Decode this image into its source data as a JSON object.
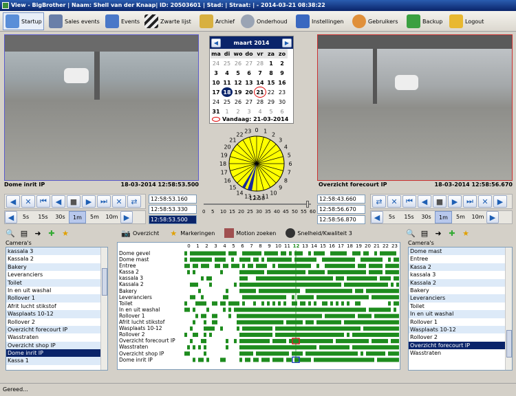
{
  "window": {
    "title": "View - BigBrother | Naam: Shell van der Knaap| ID: 20503601 | Stad: | Straat: | - 2014-03-21 08:38:22"
  },
  "toolbar": {
    "items": [
      {
        "label": "Startup",
        "icon": "home-icon"
      },
      {
        "label": "Sales events",
        "icon": "register-icon"
      },
      {
        "label": "Events",
        "icon": "monitor-icon"
      },
      {
        "label": "Zwarte lijst",
        "icon": "barrier-icon"
      },
      {
        "label": "Archief",
        "icon": "archive-icon"
      },
      {
        "label": "Onderhoud",
        "icon": "gears-icon"
      },
      {
        "label": "Instellingen",
        "icon": "checklist-icon"
      },
      {
        "label": "Gebruikers",
        "icon": "users-icon"
      },
      {
        "label": "Backup",
        "icon": "backup-icon"
      },
      {
        "label": "Logout",
        "icon": "lock-icon"
      }
    ]
  },
  "left_camera": {
    "name": "Dome inrit IP",
    "timestamp": "18-03-2014 12:58:53.500"
  },
  "right_camera": {
    "name": "Overzicht forecourt IP",
    "timestamp": "18-03-2014 12:58:56.670"
  },
  "calendar": {
    "month": "maart 2014",
    "weekdays": [
      "ma",
      "di",
      "wo",
      "do",
      "vr",
      "za",
      "zo"
    ],
    "weeks": [
      [
        "24",
        "25",
        "26",
        "27",
        "28",
        "1",
        "2"
      ],
      [
        "3",
        "4",
        "5",
        "6",
        "7",
        "8",
        "9"
      ],
      [
        "10",
        "11",
        "12",
        "13",
        "14",
        "15",
        "16"
      ],
      [
        "17",
        "18",
        "19",
        "20",
        "21",
        "22",
        "23"
      ],
      [
        "24",
        "25",
        "26",
        "27",
        "28",
        "29",
        "30"
      ],
      [
        "31",
        "1",
        "2",
        "3",
        "4",
        "5",
        "6"
      ]
    ],
    "today_label": "Vandaag: 21-03-2014",
    "selected": "18",
    "today": "21"
  },
  "clock": {
    "hours": [
      "0",
      "1",
      "2",
      "3",
      "4",
      "5",
      "6",
      "7",
      "8",
      "9",
      "10",
      "11",
      "12",
      "13",
      "14",
      "15",
      "16",
      "17",
      "18",
      "19",
      "20",
      "21",
      "22",
      "23"
    ],
    "time": "12:58",
    "filled_hours": [
      8,
      9,
      10,
      11,
      12,
      13,
      14,
      15,
      16,
      17,
      18,
      19,
      20,
      21,
      22,
      23,
      0,
      1,
      2,
      3,
      4,
      5,
      6,
      7
    ]
  },
  "slider": {
    "ticks": [
      "0",
      "5",
      "10",
      "15",
      "20",
      "25",
      "30",
      "35",
      "40",
      "45",
      "50",
      "55",
      "60"
    ],
    "value": 58
  },
  "times_left": [
    "12:58:53.160",
    "12:58:53.330",
    "12:58:53.500"
  ],
  "times_right": [
    "12:58:43.660",
    "12:58:56.670",
    "12:58:56.870"
  ],
  "zoom": [
    "5s",
    "15s",
    "30s",
    "1m",
    "5m",
    "10m"
  ],
  "zoom_selected": "1m",
  "tabs": [
    {
      "label": "Overzicht",
      "icon": "camera-icon"
    },
    {
      "label": "Markeringen",
      "icon": "star-icon"
    },
    {
      "label": "Motion zoeken",
      "icon": "motion-icon"
    },
    {
      "label": "Snelheid/Kwaliteit 3",
      "icon": "speed-icon"
    }
  ],
  "left_list": {
    "title": "Camera's",
    "items": [
      "kassala 3",
      "Kassala 2",
      "Bakery",
      "Leveranciers",
      "Toilet",
      "In en uit washal",
      "Rollover 1",
      "Afrit lucht stikstof",
      "Wasplaats 10-12",
      "Rollover 2",
      "Overzicht forecourt IP",
      "Wasstraten",
      "Overzicht shop IP",
      "Dome inrit IP",
      "Kassa 1"
    ],
    "selected": "Dome inrit IP"
  },
  "right_list": {
    "title": "Camera's",
    "items": [
      "Dome mast",
      "Entree",
      "Kassa 2",
      "kassala 3",
      "Kassala 2",
      "Bakery",
      "Leveranciers",
      "Toilet",
      "In en uit washal",
      "Rollover 1",
      "Wasplaats 10-12",
      "Rollover 2",
      "Overzicht forecourt IP",
      "Wasstraten"
    ],
    "selected": "Overzicht forecourt IP"
  },
  "grid": {
    "hours": [
      "0",
      "1",
      "2",
      "3",
      "4",
      "5",
      "6",
      "7",
      "8",
      "9",
      "10",
      "11",
      "12",
      "13",
      "14",
      "15",
      "16",
      "17",
      "18",
      "19",
      "20",
      "21",
      "22",
      "23"
    ],
    "rows": [
      "Dome gevel",
      "Dome mast",
      "Entree",
      "Kassa 2",
      "kassala 3",
      "Kassala 2",
      "Bakery",
      "Leveranciers",
      "Toilet",
      "In en uit washal",
      "Rollover 1",
      "Afrit lucht stikstof",
      "Wasplaats 10-12",
      "Rollover 2",
      "Overzicht forecourt IP",
      "Wasstraten",
      "Overzicht shop IP",
      "Dome inrit IP"
    ],
    "highlight_hour": "12",
    "accent": "#1e8c1e"
  },
  "status": {
    "text": "Gereed..."
  }
}
